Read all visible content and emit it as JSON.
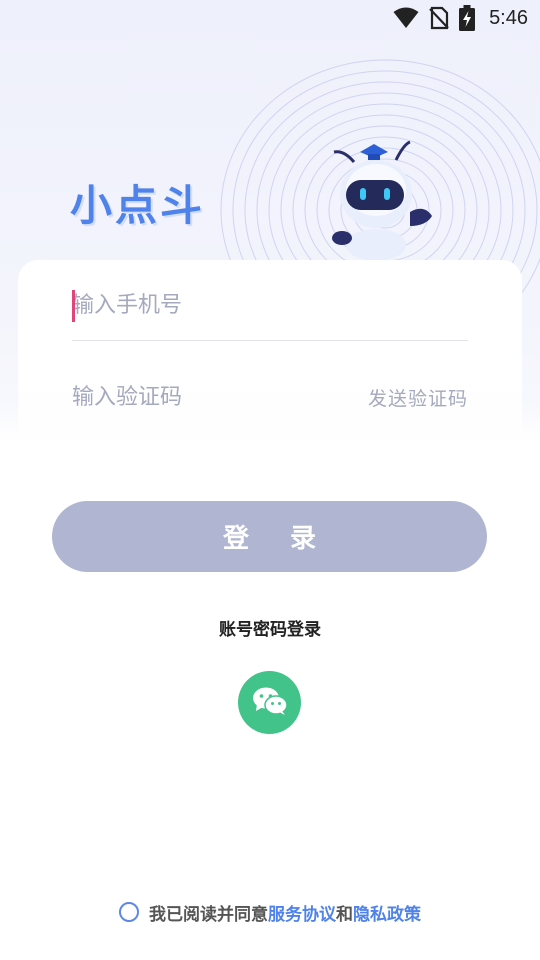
{
  "status_bar": {
    "time": "5:46"
  },
  "app": {
    "title": "小点斗"
  },
  "form": {
    "phone_placeholder": "输入手机号",
    "code_placeholder": "输入验证码",
    "send_code_label": "发送验证码"
  },
  "login_button_label": "登 录",
  "account_login_label": "账号密码登录",
  "agreement": {
    "prefix": "我已阅读并同意",
    "service_link": "服务协议",
    "and": "和",
    "privacy_link": "隐私政策"
  },
  "colors": {
    "accent": "#4f82ea",
    "login_button": "#b0b6d1",
    "wechat": "#42c38a"
  },
  "icons": [
    "wifi-icon",
    "no-sim-icon",
    "battery-charging-icon",
    "wechat-icon",
    "robot-mascot"
  ]
}
